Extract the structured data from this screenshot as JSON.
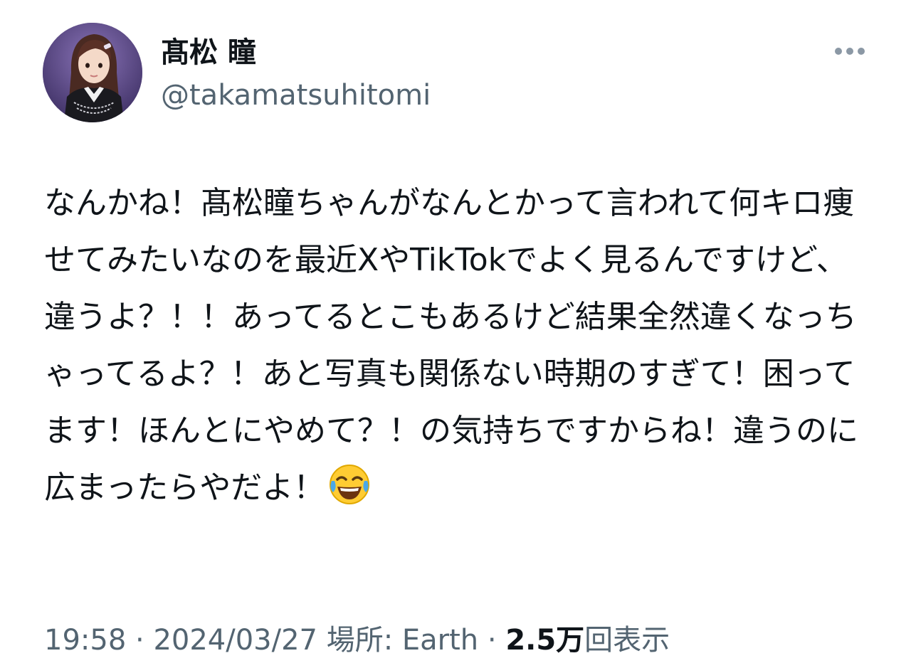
{
  "author": {
    "display_name": "髙松 瞳",
    "handle": "@takamatsuhitomi"
  },
  "menu": {
    "icon": "more-horizontal-icon"
  },
  "tweet": {
    "text": "なんかね！髙松瞳ちゃんがなんとかって言われて何キロ痩せてみたいなのを最近XやTikTokでよく見るんですけど、違うよ？！！あってるとこもあるけど結果全然違くなっちゃってるよ？！あと写真も関係ない時期のすぎて！困ってます！ほんとにやめて？！の気持ちですからね！違うのに広まったらやだよ！",
    "emoji": "face-with-tears-of-joy-emoji"
  },
  "meta": {
    "time": "19:58",
    "sep1": " · ",
    "date": "2024/03/27",
    "location": " 場所: Earth",
    "sep2": " · ",
    "views_count": "2.5万",
    "views_label": "回表示"
  },
  "colors": {
    "text_primary": "#0f1419",
    "text_secondary": "#536471",
    "avatar_bg": "#5b4a86"
  }
}
